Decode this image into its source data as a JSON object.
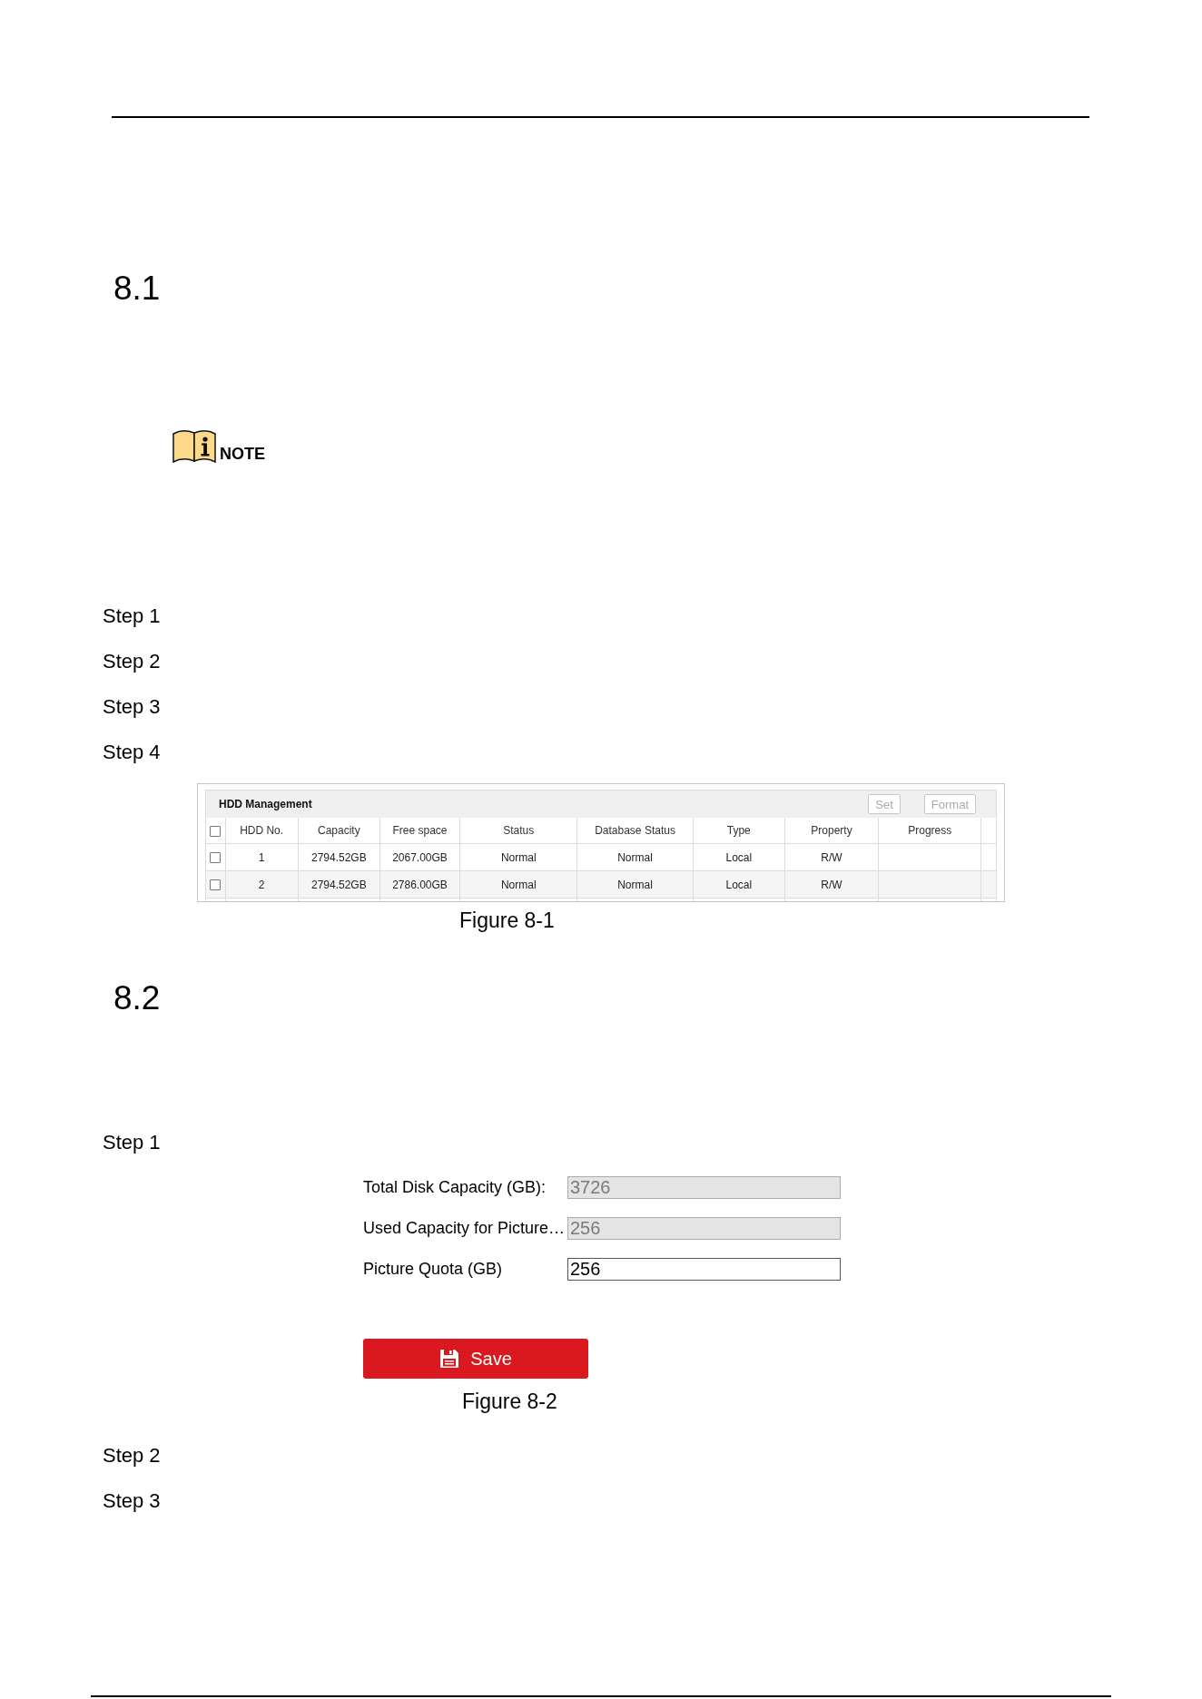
{
  "section_1": {
    "number": "8.1",
    "note": {
      "label": "NOTE"
    },
    "steps": [
      "Step 1",
      "Step 2",
      "Step 3",
      "Step 4"
    ],
    "figure": {
      "panel": {
        "title": "HDD Management",
        "buttons": [
          {
            "label": "Set",
            "disabled": true
          },
          {
            "label": "Format",
            "disabled": true
          }
        ],
        "select_all": {
          "checked": false
        },
        "columns": [
          "HDD No.",
          "Capacity",
          "Free space",
          "Status",
          "Database Status",
          "Type",
          "Property",
          "Progress"
        ],
        "rows": [
          {
            "checked": false,
            "cells": [
              "1",
              "2794.52GB",
              "2067.00GB",
              "Normal",
              "Normal",
              "Local",
              "R/W"
            ]
          },
          {
            "checked": false,
            "cells": [
              "2",
              "2794.52GB",
              "2786.00GB",
              "Normal",
              "Normal",
              "Local",
              "R/W"
            ]
          }
        ]
      },
      "caption": "Figure 8-1"
    }
  },
  "section_2": {
    "number": "8.2",
    "steps_before": [
      "Step 1"
    ],
    "figure": {
      "fields": [
        {
          "label": "Total Disk Capacity (GB):",
          "value": "3726",
          "disabled": true
        },
        {
          "label": "Used Capacity for Picture…",
          "value": "256",
          "disabled": true
        },
        {
          "label": "Picture Quota (GB)",
          "value": "256",
          "disabled": false
        }
      ],
      "save_button": {
        "label": "Save"
      }
    },
    "caption": "Figure 8-2",
    "steps_after": [
      "Step 2",
      "Step 3"
    ]
  }
}
